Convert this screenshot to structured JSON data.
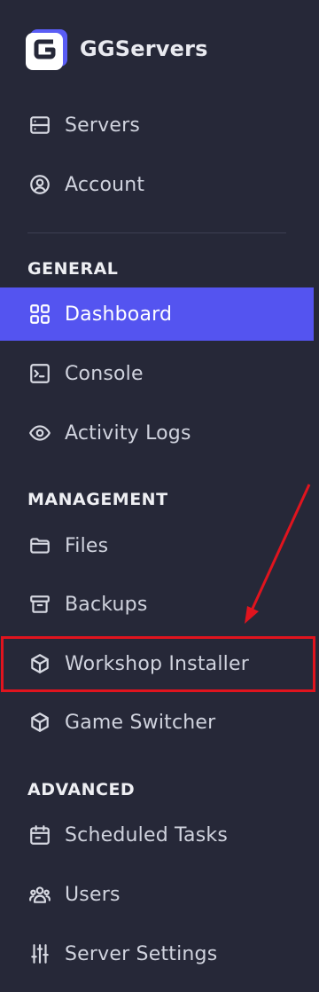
{
  "brand": {
    "name": "GGServers"
  },
  "top_items": [
    {
      "label": "Servers",
      "icon": "server-icon"
    },
    {
      "label": "Account",
      "icon": "account-icon"
    }
  ],
  "sections": {
    "general": "GENERAL",
    "management": "MANAGEMENT",
    "advanced": "ADVANCED"
  },
  "general_items": [
    {
      "label": "Dashboard",
      "icon": "grid-icon",
      "active": true
    },
    {
      "label": "Console",
      "icon": "terminal-icon"
    },
    {
      "label": "Activity Logs",
      "icon": "eye-icon"
    }
  ],
  "management_items": [
    {
      "label": "Files",
      "icon": "folder-icon"
    },
    {
      "label": "Backups",
      "icon": "archive-icon"
    },
    {
      "label": "Workshop Installer",
      "icon": "cube-icon"
    },
    {
      "label": "Game Switcher",
      "icon": "cube-icon"
    }
  ],
  "advanced_items": [
    {
      "label": "Scheduled Tasks",
      "icon": "calendar-icon"
    },
    {
      "label": "Users",
      "icon": "users-icon"
    },
    {
      "label": "Server Settings",
      "icon": "sliders-icon"
    }
  ],
  "colors": {
    "background": "#262838",
    "active": "#5454f0",
    "annotation": "#e0141e"
  }
}
